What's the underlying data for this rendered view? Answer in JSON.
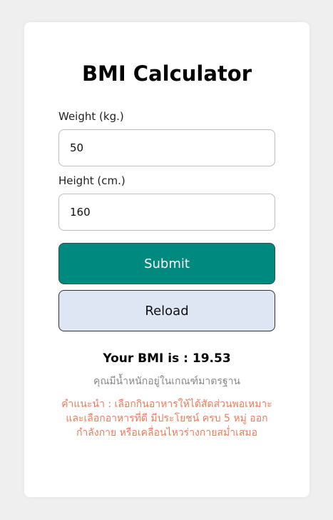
{
  "app": {
    "title": "BMI Calculator"
  },
  "form": {
    "weight_label": "Weight (kg.)",
    "weight_value": "50",
    "height_label": "Height (cm.)",
    "height_value": "160",
    "submit_label": "Submit",
    "reload_label": "Reload"
  },
  "result": {
    "bmi_text": "Your BMI is : 19.53",
    "status_text": "คุณมีน้ำหนักอยู่ในเกณฑ์มาตรฐาน",
    "advice_text": "คำแนะนำ : เลือกกินอาหารให้ได้สัดส่วนพอเหมาะ และเลือกอาหารที่ดี มีประโยชน์ ครบ 5 หมู่ ออกกำลังกาย หรือเคลื่อนไหวร่างกายสม่ำเสมอ"
  },
  "colors": {
    "submit_bg": "#00897f",
    "reload_bg": "#dde6f2",
    "advice_text": "#f07b5a",
    "status_text": "#888888"
  }
}
